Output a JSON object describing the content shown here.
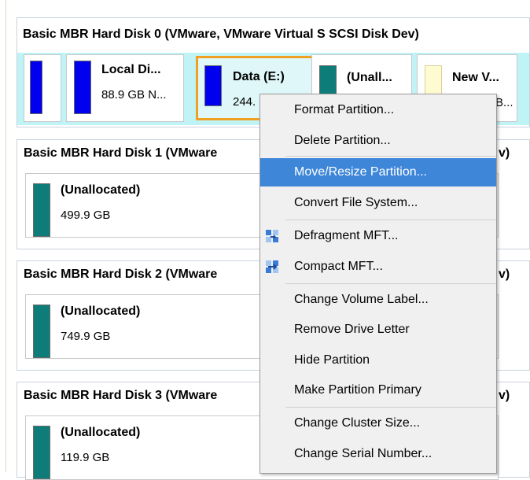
{
  "disks": [
    {
      "title": "Basic MBR Hard Disk 0 (VMware, VMware Virtual S SCSI Disk Dev)",
      "partitions": [
        {
          "name": "",
          "size": "",
          "color": "#0000ee"
        },
        {
          "name": "Local Di...",
          "size": "88.9 GB N...",
          "color": "#0000ee"
        },
        {
          "name": "Data (E:)",
          "size": "244.",
          "color": "#0000ee",
          "selected": true
        },
        {
          "name": "(Unall...",
          "size": "",
          "color": "#0e7c78"
        },
        {
          "name": "New V...",
          "size": "B...",
          "color": "#fffbd0"
        }
      ]
    },
    {
      "title": "Basic MBR Hard Disk 1 (VMware",
      "title_tail": "v)",
      "partitions": [
        {
          "name": "(Unallocated)",
          "size": "499.9 GB",
          "color": "#0e7c78"
        }
      ]
    },
    {
      "title": "Basic MBR Hard Disk 2 (VMware",
      "title_tail": "v)",
      "partitions": [
        {
          "name": "(Unallocated)",
          "size": "749.9 GB",
          "color": "#0e7c78"
        }
      ]
    },
    {
      "title": "Basic MBR Hard Disk 3 (VMware",
      "title_tail": "v)",
      "partitions": [
        {
          "name": "(Unallocated)",
          "size": "119.9 GB",
          "color": "#0e7c78"
        }
      ]
    }
  ],
  "context_menu": {
    "items": [
      {
        "label": "Format Partition..."
      },
      {
        "label": "Delete Partition..."
      },
      {
        "label": "Move/Resize Partition...",
        "highlighted": true
      },
      {
        "label": "Convert File System..."
      },
      {
        "label": "Defragment MFT...",
        "icon": "defragment-icon"
      },
      {
        "label": "Compact MFT...",
        "icon": "compact-icon"
      },
      {
        "label": "Change Volume Label..."
      },
      {
        "label": "Remove Drive Letter"
      },
      {
        "label": "Hide Partition"
      },
      {
        "label": "Make Partition Primary"
      },
      {
        "label": "Change Cluster Size..."
      },
      {
        "label": "Change Serial Number..."
      }
    ]
  },
  "colors": {
    "selected_border": "#f0a020",
    "selected_bg": "#bff3f5",
    "menu_highlight": "#3e86d8"
  }
}
